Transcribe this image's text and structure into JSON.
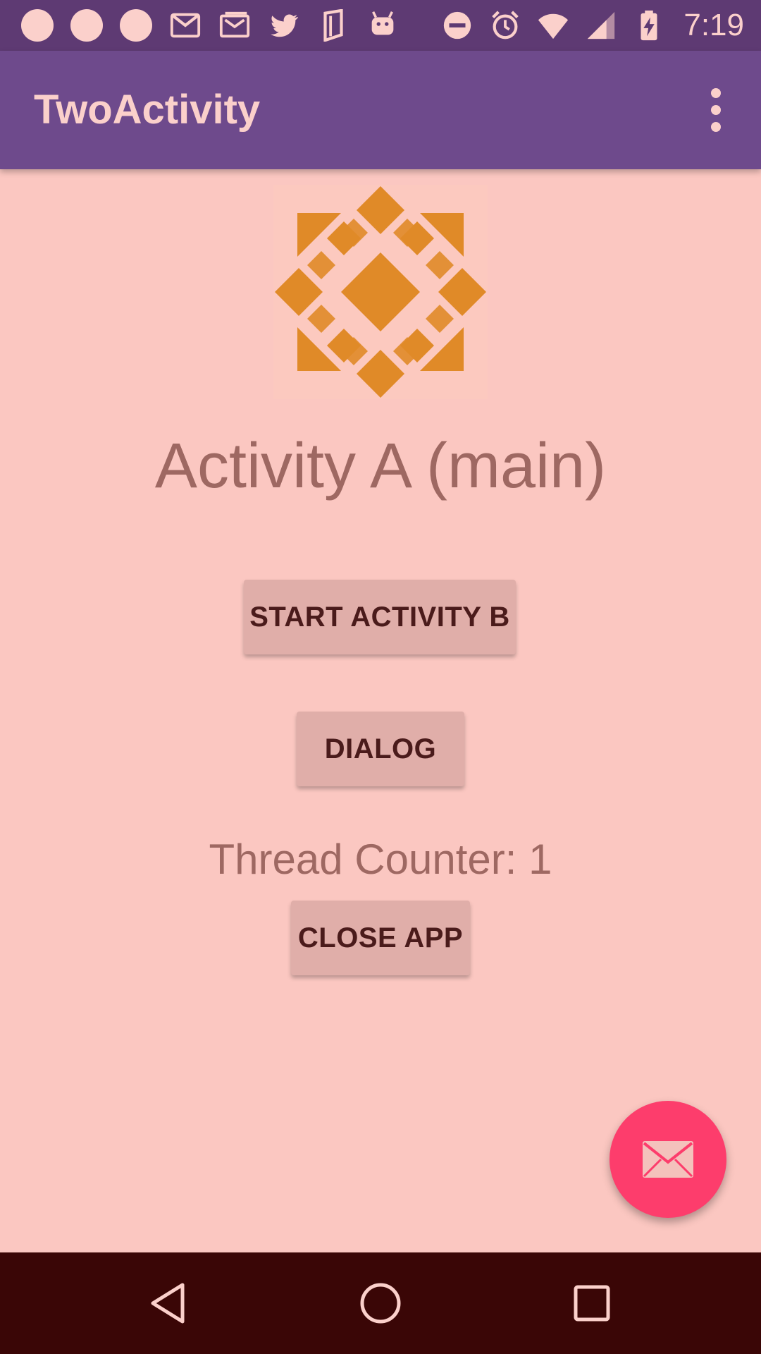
{
  "status_bar": {
    "time": "7:19",
    "left_icons": [
      "circle-notification-icon",
      "circle-notification-icon",
      "circle-notification-icon",
      "gmail-icon",
      "photo-mail-icon",
      "twitter-icon",
      "flag-icon",
      "android-icon"
    ],
    "right_icons": [
      "do-not-disturb-icon",
      "alarm-icon",
      "wifi-icon",
      "cell-signal-icon",
      "battery-charging-icon"
    ]
  },
  "app_bar": {
    "title": "TwoActivity",
    "overflow_icon": "more-vert-icon"
  },
  "main": {
    "logo_icon": "geometric-diamond-logo",
    "activity_title": "Activity A (main)",
    "start_activity_b_label": "START ACTIVITY B",
    "dialog_label": "DIALOG",
    "thread_counter": "Thread Counter: 1",
    "close_app_label": "CLOSE APP"
  },
  "fab": {
    "icon": "mail-icon"
  },
  "nav_bar": {
    "back_icon": "back-triangle-icon",
    "home_icon": "home-circle-icon",
    "recents_icon": "recents-square-icon"
  },
  "colors": {
    "background": "#fbc7c1",
    "status_bar": "#5e3a73",
    "app_bar": "#6e4a8c",
    "fab": "#fd3d6c",
    "logo_orange": "#e08a28",
    "nav_bar": "#3a0606"
  }
}
